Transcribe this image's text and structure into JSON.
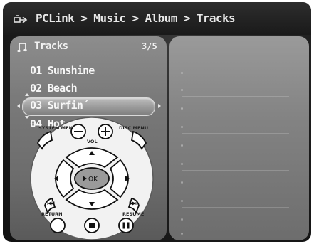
{
  "header": {
    "breadcrumb": "PCLink > Music > Album > Tracks",
    "icon": "pc-link-icon"
  },
  "panel": {
    "title": "Tracks",
    "counter": "3/5",
    "icon": "music-note-icon"
  },
  "tracks": [
    {
      "label": "01 Sunshine"
    },
    {
      "label": "02 Beach"
    },
    {
      "label": "03 Surfin´",
      "selected": true
    },
    {
      "label": "04 Hot"
    }
  ],
  "remote": {
    "vol_label": "VOL",
    "ok_label": "OK",
    "system_menu_label": "SYSTEM MENU",
    "disc_menu_label": "DISC MENU",
    "return_label": "RETURN",
    "resume_label": "RESUME"
  },
  "colors": {
    "background": "#1c1c1c",
    "panel": "#7a7a7a",
    "selection": "#a8a8a8",
    "text": "#f7f7f7"
  }
}
